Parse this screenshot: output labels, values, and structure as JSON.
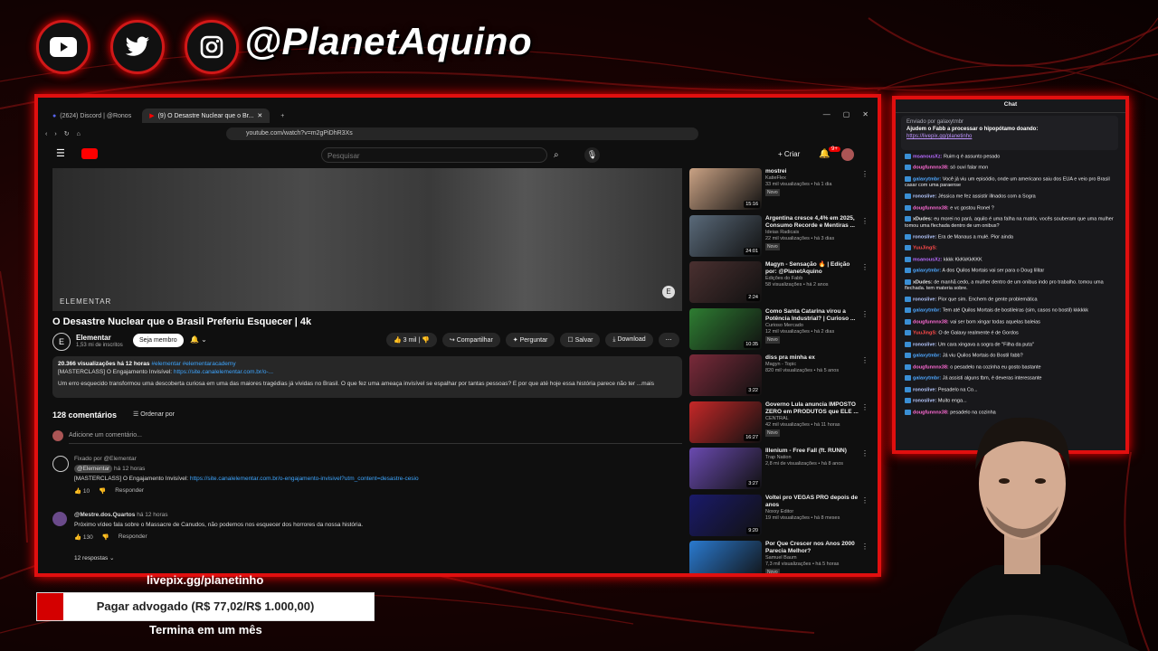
{
  "overlay": {
    "handle": "@PlanetAquino",
    "social_icons": [
      "youtube-icon",
      "twitter-icon",
      "instagram-icon"
    ],
    "accent_color": "#e10f0f"
  },
  "browser": {
    "tabs": [
      {
        "label": "(2624) Discord | @Ronos"
      },
      {
        "label": "(9) O Desastre Nuclear que o Br..."
      }
    ],
    "url": "youtube.com/watch?v=m2gPiDhR3Xs"
  },
  "youtube": {
    "search_placeholder": "Pesquisar",
    "create_label": "+ Criar",
    "notif_badge": "9+",
    "player_watermark": "ELEMENTAR",
    "video_title": "O Desastre Nuclear que o Brasil Preferiu Esquecer | 4k",
    "channel": {
      "avatar_letter": "E",
      "name": "Elementar",
      "subs": "1,53 mi de inscritos",
      "join_label": "Seja membro"
    },
    "actions": {
      "likes": "3 mil",
      "share": "Compartilhar",
      "ask": "Perguntar",
      "save": "Salvar",
      "download": "Download"
    },
    "description": {
      "stats": "20.366 visualizações  há 12 horas",
      "tags": "#elementar #elementaracademy",
      "line2": "[MASTERCLASS] O Engajamento Invisível: ",
      "line2_link": "https://site.canalelementar.com.br/o-...",
      "text": "Um erro esquecido transformou uma descoberta curiosa em uma das maiores tragédias já vividas no Brasil. O que fez uma ameaça invisível se espalhar por tantas pessoas? E por que até hoje essa história parece não ter ...mais"
    },
    "comments_count": "128 comentários",
    "order_label": "Ordenar por",
    "add_comment": "Adicione um comentário...",
    "comments": [
      {
        "pinned": "Fixado por @Elementar",
        "author": "@Elementar",
        "time": "há 12 horas",
        "text": "[MASTERCLASS] O Engajamento Invisível: ",
        "link": "https://site.canalelementar.com.br/o-engajamento-invisivel?utm_content=desastre-cesio",
        "likes": "10",
        "reply": "Responder"
      },
      {
        "author": "@Mestre.dos.Quartos",
        "time": "há 12 horas",
        "text": "Próximo vídeo fala sobre o Massacre de Canudos, não podemos nos esquecer dos horrores da nossa história.",
        "likes": "130",
        "reply": "Responder",
        "replies": "12 respostas"
      }
    ],
    "sidebar": [
      {
        "title": "mostrei",
        "channel": "KatieFlex",
        "stats": "33 mil visualizações • há 1 dia",
        "new": "Novo",
        "dur": "15:16",
        "thumb": "#caa284"
      },
      {
        "title": "Argentina cresce 4,4% em 2025, Consumo Recorde e Mentiras ...",
        "channel": "Ideias Radicais",
        "stats": "22 mil visualizações • há 3 dias",
        "new": "Novo",
        "dur": "24:01",
        "thumb": "#5a6a7a"
      },
      {
        "title": "Magyn - Sensação 🔥 | Edição por: @PlanetAquino",
        "channel": "Edições do Fabb",
        "stats": "58 visualizações • há 2 anos",
        "new": "",
        "dur": "2:24",
        "thumb": "#4a3030"
      },
      {
        "title": "Como Santa Catarina virou a Potência Industrial? | Curioso ...",
        "channel": "Curioso Mercado",
        "stats": "12 mil visualizações • há 2 dias",
        "new": "Novo",
        "dur": "10:35",
        "thumb": "#2e7d32"
      },
      {
        "title": "diss pra minha ex",
        "channel": "Magyn - Topic",
        "stats": "820 mil visualizações • há 5 anos",
        "new": "",
        "dur": "3:22",
        "thumb": "#7a2a3a"
      },
      {
        "title": "Governo Lula anuncia IMPOSTO ZERO em PRODUTOS que ELE ...",
        "channel": "CENTRAL",
        "stats": "42 mil visualizações • há 11 horas",
        "new": "Novo",
        "dur": "16:27",
        "thumb": "#c62828"
      },
      {
        "title": "Illenium - Free Fall (ft. RUNN)",
        "channel": "Trap Nation",
        "stats": "2,8 mi de visualizações • há 8 anos",
        "new": "",
        "dur": "3:27",
        "thumb": "#6a4ab0"
      },
      {
        "title": "Voltei pro VEGAS PRO depois de anos",
        "channel": "Noxxy Editor",
        "stats": "19 mil visualizações • há 8 meses",
        "new": "",
        "dur": "9:20",
        "thumb": "#1a1a6a"
      },
      {
        "title": "Por Que Crescer nos Anos 2000 Parecia Melhor?",
        "channel": "Samuel Baum",
        "stats": "7,3 mil visualizações • há 5 horas",
        "new": "Novo",
        "dur": "21:53",
        "thumb": "#2a7ad0"
      }
    ]
  },
  "chat": {
    "title": "Chat",
    "pinned_by": "Enviado por  galaxytmbr",
    "pinned_text": "Ajudem o Fabb a processar o hipopótamo doando:",
    "pinned_link": "https://livepix.gg/planetinho",
    "messages": [
      {
        "user": "msanousXz:",
        "color": "#b86bff",
        "text": "Ruim q é assunto pesado"
      },
      {
        "user": "dougfunnnx38:",
        "color": "#ff6bd5",
        "text": "só ouvi falar mon"
      },
      {
        "user": "galaxytmbr:",
        "color": "#4ea7ff",
        "text": "Você já viu um episódio, onde um americano saiu dos EUA e veio pro Brasil casar com uma paraense"
      },
      {
        "user": "ronoslive:",
        "color": "#b7c9ff",
        "text": "Jéssica me fez assistir illnados com a Sogra"
      },
      {
        "user": "dougfunnnx38:",
        "color": "#ff6bd5",
        "text": "e vc gostou Ronel ?"
      },
      {
        "user": "xDudes:",
        "color": "#e6e6e6",
        "text": "eu morei no pará. aquilo é uma falha na matrix. vocês souberam que uma mulher tomou uma flechada dentro de um onibus?"
      },
      {
        "user": "ronoslive:",
        "color": "#b7c9ff",
        "text": "Era de Manaus a mulé. Pior ainda"
      },
      {
        "user": "YuuJingS:",
        "color": "#ff4a4a",
        "text": ""
      },
      {
        "user": "msanousXz:",
        "color": "#b86bff",
        "text": "kkkk KkKkKkKKK"
      },
      {
        "user": "galaxytmbr:",
        "color": "#4ea7ff",
        "text": "A dos Quilos Mortais vai ser para o Doug lilitar"
      },
      {
        "user": "xDudes:",
        "color": "#e6e6e6",
        "text": "de manhã cedo, a mulher dentro de um onibus indo pro trabalho. tomou uma flechada. tem materia sobre."
      },
      {
        "user": "ronoslive:",
        "color": "#b7c9ff",
        "text": "Pior que sim. Enchem de gente problemática"
      },
      {
        "user": "galaxytmbr:",
        "color": "#4ea7ff",
        "text": "Tem até Quilos Mortais de bostileiras (sim, casos no bostil) kkkkkk"
      },
      {
        "user": "dougfunnnx38:",
        "color": "#ff6bd5",
        "text": "vai ser bom xingar todas aquelas baleias"
      },
      {
        "user": "YuuJingS:",
        "color": "#ff4a4a",
        "text": "O de Galaxy realmente é de Gordos"
      },
      {
        "user": "ronoslive:",
        "color": "#b7c9ff",
        "text": "Um cara xingava a sogra de \"Filha da puta\""
      },
      {
        "user": "galaxytmbr:",
        "color": "#4ea7ff",
        "text": "Já viu Quilos Mortais do Bostil fabb?"
      },
      {
        "user": "dougfunnnx38:",
        "color": "#ff6bd5",
        "text": "o pesadelo na cozinha eu gosto bastante"
      },
      {
        "user": "galaxytmbr:",
        "color": "#4ea7ff",
        "text": "Já assisti alguns tbm, é deveras interessante"
      },
      {
        "user": "ronoslive:",
        "color": "#b7c9ff",
        "text": "Pesadelo na Co..."
      },
      {
        "user": "ronoslive:",
        "color": "#b7c9ff",
        "text": "Muito enga..."
      },
      {
        "user": "dougfunnnx38:",
        "color": "#ff6bd5",
        "text": "pesadelo na cozinha"
      }
    ]
  },
  "donation": {
    "link": "livepix.gg/planetinho",
    "goal_label": "Pagar advogado (R$ 77,02/R$ 1.000,00)",
    "goal_fraction": 0.077,
    "ends": "Termina em um mês"
  }
}
